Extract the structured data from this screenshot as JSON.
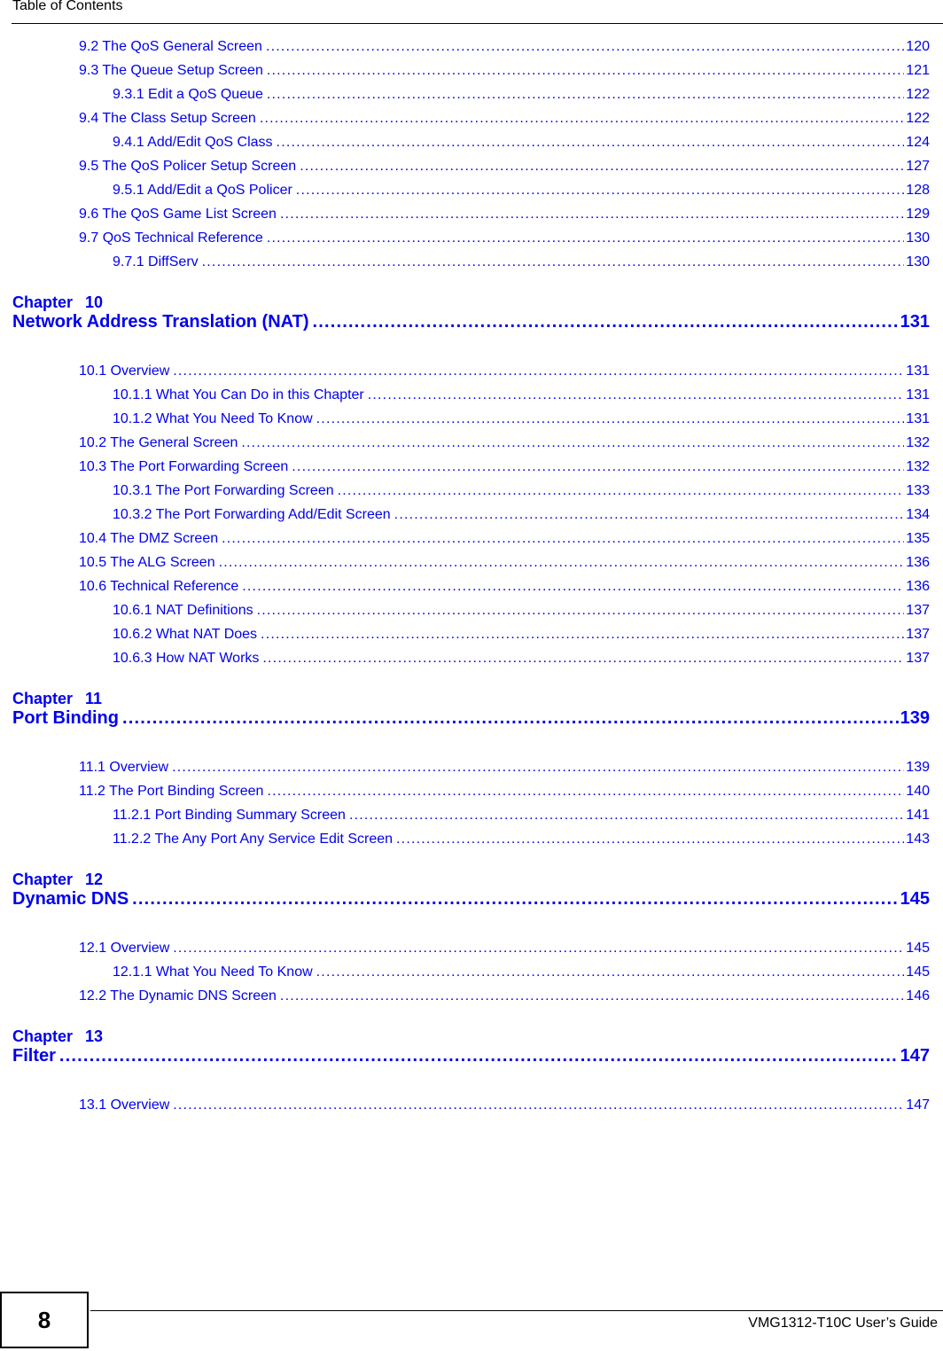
{
  "header": {
    "title": "Table of Contents"
  },
  "sections": [
    {
      "type": "entry",
      "level": 1,
      "label": "9.2 The QoS General Screen",
      "page": "120"
    },
    {
      "type": "entry",
      "level": 1,
      "label": "9.3 The Queue Setup Screen",
      "page": "121"
    },
    {
      "type": "entry",
      "level": 2,
      "label": "9.3.1 Edit a QoS Queue",
      "page": "122"
    },
    {
      "type": "entry",
      "level": 1,
      "label": "9.4 The Class Setup Screen",
      "page": "122"
    },
    {
      "type": "entry",
      "level": 2,
      "label": "9.4.1 Add/Edit QoS Class",
      "page": "124"
    },
    {
      "type": "entry",
      "level": 1,
      "label": "9.5 The QoS Policer Setup Screen",
      "page": "127"
    },
    {
      "type": "entry",
      "level": 2,
      "label": "9.5.1 Add/Edit a QoS Policer",
      "page": "128"
    },
    {
      "type": "entry",
      "level": 1,
      "label": "9.6 The QoS Game List Screen",
      "page": "129"
    },
    {
      "type": "entry",
      "level": 1,
      "label": "9.7 QoS Technical Reference",
      "page": "130"
    },
    {
      "type": "entry",
      "level": 2,
      "label": "9.7.1 DiffServ",
      "page": "130"
    },
    {
      "type": "chapter",
      "chapter_word": "Chapter",
      "number": "10",
      "title": "Network Address Translation (NAT)",
      "page": "131"
    },
    {
      "type": "entry",
      "level": 1,
      "label": "10.1 Overview",
      "page": "131"
    },
    {
      "type": "entry",
      "level": 2,
      "label": "10.1.1 What You Can Do in this Chapter",
      "page": "131"
    },
    {
      "type": "entry",
      "level": 2,
      "label": "10.1.2 What You Need To Know",
      "page": "131"
    },
    {
      "type": "entry",
      "level": 1,
      "label": "10.2 The General Screen",
      "page": "132"
    },
    {
      "type": "entry",
      "level": 1,
      "label": "10.3 The Port Forwarding Screen",
      "page": "132"
    },
    {
      "type": "entry",
      "level": 2,
      "label": "10.3.1 The Port Forwarding Screen",
      "page": "133"
    },
    {
      "type": "entry",
      "level": 2,
      "label": "10.3.2 The Port Forwarding Add/Edit Screen",
      "page": "134"
    },
    {
      "type": "entry",
      "level": 1,
      "label": "10.4 The DMZ Screen",
      "page": "135"
    },
    {
      "type": "entry",
      "level": 1,
      "label": "10.5 The ALG Screen",
      "page": "136"
    },
    {
      "type": "entry",
      "level": 1,
      "label": "10.6 Technical Reference",
      "page": "136"
    },
    {
      "type": "entry",
      "level": 2,
      "label": "10.6.1 NAT Definitions",
      "page": "137"
    },
    {
      "type": "entry",
      "level": 2,
      "label": "10.6.2 What NAT Does",
      "page": "137"
    },
    {
      "type": "entry",
      "level": 2,
      "label": "10.6.3 How NAT Works",
      "page": "137"
    },
    {
      "type": "chapter",
      "chapter_word": "Chapter",
      "number": "11",
      "title": "Port Binding",
      "page": "139"
    },
    {
      "type": "entry",
      "level": 1,
      "label": "11.1 Overview",
      "page": "139"
    },
    {
      "type": "entry",
      "level": 1,
      "label": "11.2 The Port Binding Screen",
      "page": "140"
    },
    {
      "type": "entry",
      "level": 2,
      "label": "11.2.1 Port Binding Summary Screen",
      "page": "141"
    },
    {
      "type": "entry",
      "level": 2,
      "label": "11.2.2 The Any Port Any Service Edit Screen",
      "page": "143"
    },
    {
      "type": "chapter",
      "chapter_word": "Chapter",
      "number": "12",
      "title": "Dynamic DNS",
      "page": "145"
    },
    {
      "type": "entry",
      "level": 1,
      "label": "12.1 Overview",
      "page": "145"
    },
    {
      "type": "entry",
      "level": 2,
      "label": "12.1.1 What You Need To Know",
      "page": "145"
    },
    {
      "type": "entry",
      "level": 1,
      "label": "12.2 The Dynamic DNS Screen",
      "page": "146"
    },
    {
      "type": "chapter",
      "chapter_word": "Chapter",
      "number": "13",
      "title": "Filter",
      "page": "147"
    },
    {
      "type": "entry",
      "level": 1,
      "label": "13.1 Overview",
      "page": "147"
    }
  ],
  "footer": {
    "page_number": "8",
    "guide_title": "VMG1312-T10C User’s Guide"
  },
  "colors": {
    "link": "#0000ee",
    "text": "#000000"
  }
}
